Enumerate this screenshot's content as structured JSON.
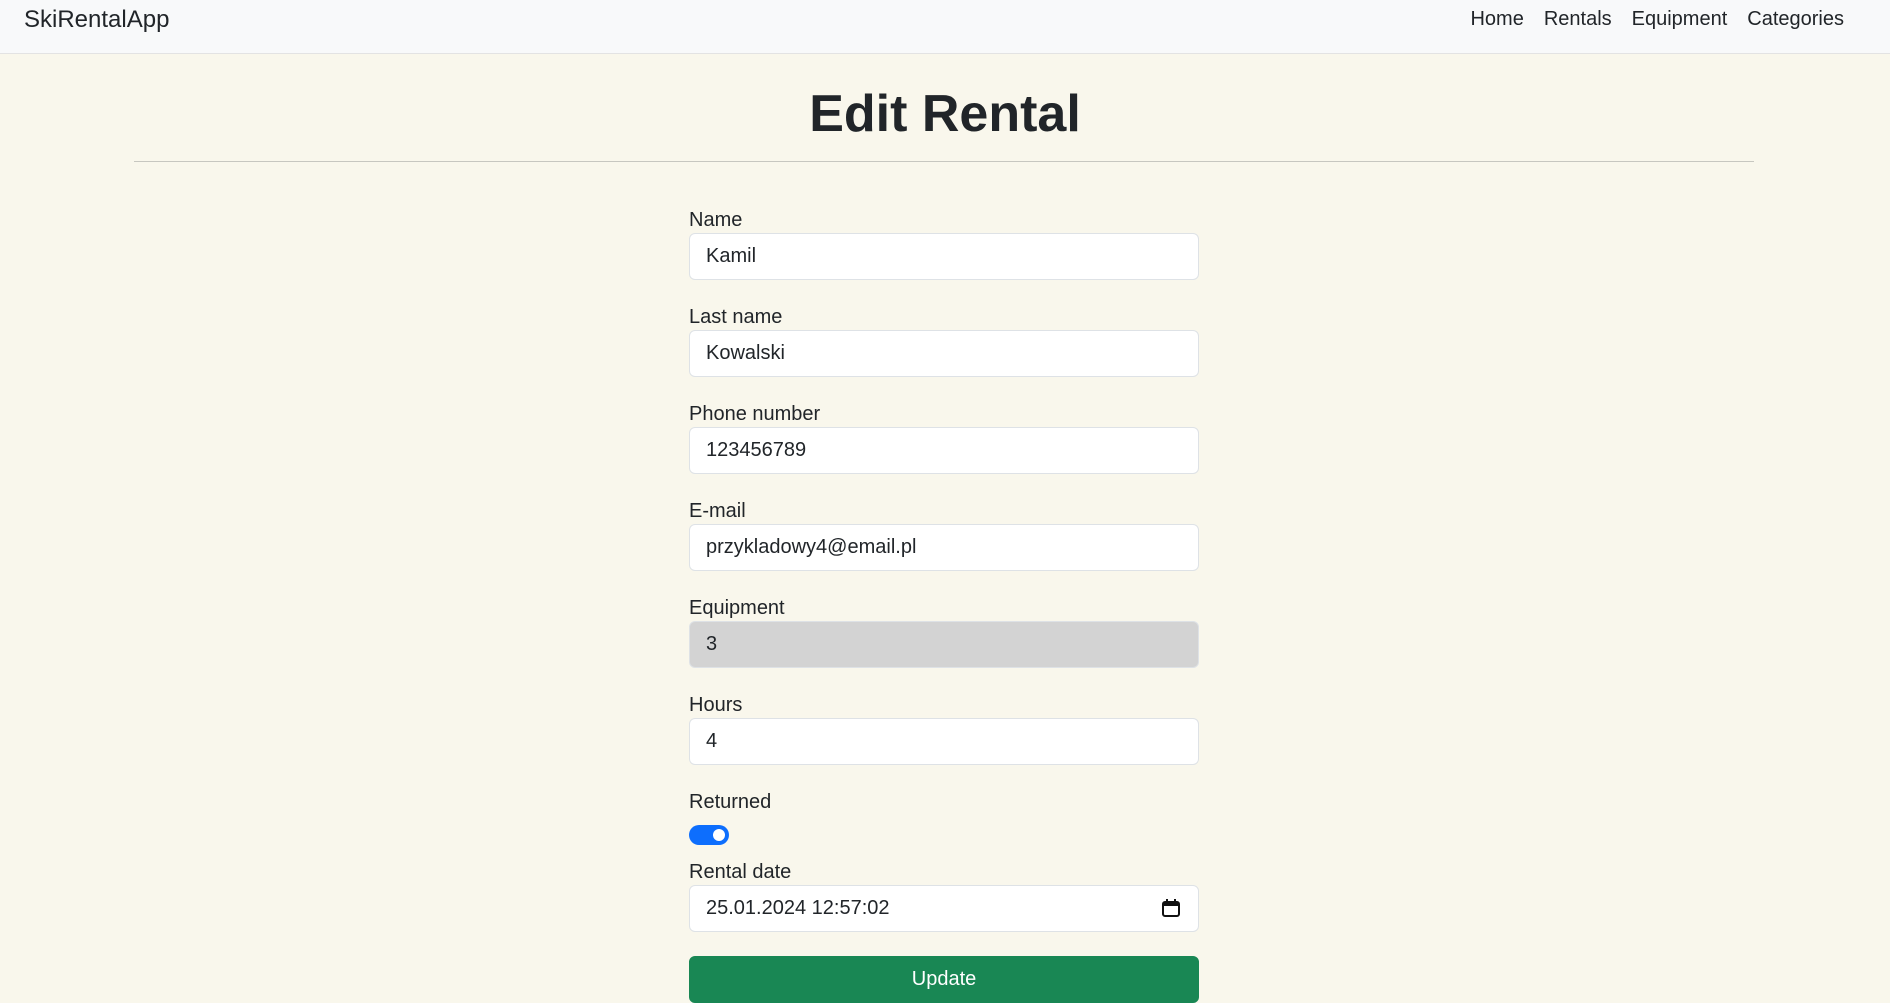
{
  "navbar": {
    "brand": "SkiRentalApp",
    "links": [
      "Home",
      "Rentals",
      "Equipment",
      "Categories"
    ]
  },
  "page": {
    "title": "Edit Rental"
  },
  "form": {
    "name": {
      "label": "Name",
      "value": "Kamil"
    },
    "last_name": {
      "label": "Last name",
      "value": "Kowalski"
    },
    "phone": {
      "label": "Phone number",
      "value": "123456789"
    },
    "email": {
      "label": "E-mail",
      "value": "przykladowy4@email.pl"
    },
    "equipment": {
      "label": "Equipment",
      "value": "3",
      "disabled": true
    },
    "hours": {
      "label": "Hours",
      "value": "4"
    },
    "returned": {
      "label": "Returned",
      "checked": true
    },
    "rental_date": {
      "label": "Rental date",
      "value": "25.01.2024 12:57:02"
    },
    "submit_label": "Update"
  },
  "colors": {
    "background": "#f9f7ec",
    "toggle_on": "#0d6efd",
    "submit": "#198754",
    "disabled_input": "#d3d3d3"
  },
  "icons": {
    "date_picker": "calendar-icon"
  }
}
